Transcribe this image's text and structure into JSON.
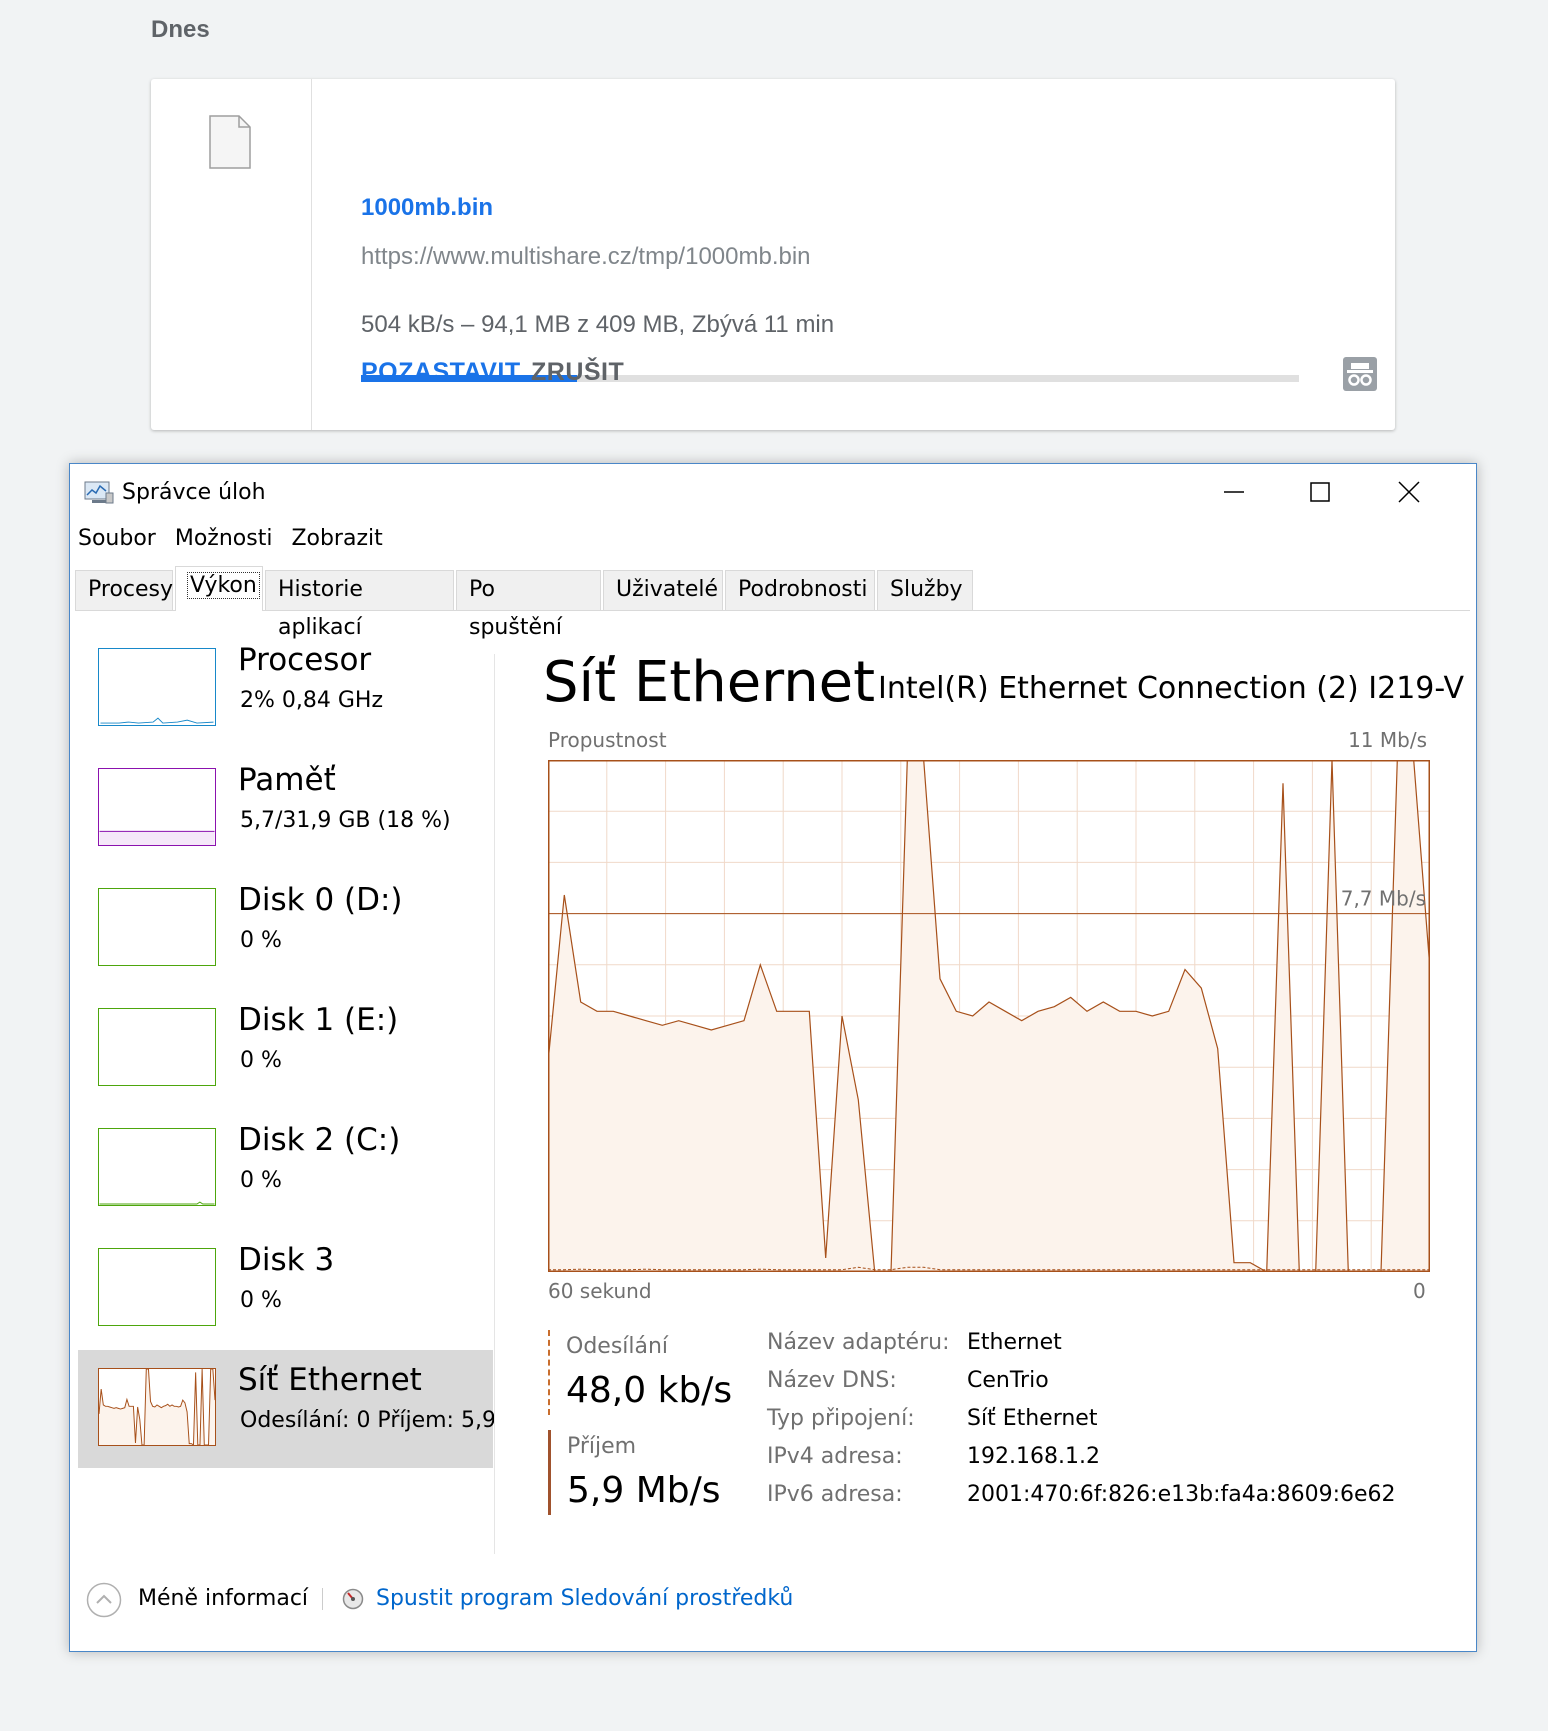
{
  "downloads": {
    "day_label": "Dnes",
    "item": {
      "file_name": "1000mb.bin",
      "url": "https://www.multishare.cz/tmp/1000mb.bin",
      "status": "504 kB/s – 94,1 MB z 409 MB, Zbývá 11 min",
      "progress_fraction": 0.23,
      "pause_label": "POZASTAVIT",
      "cancel_label": "ZRUŠIT",
      "incognito_icon": "incognito-icon"
    },
    "colors": {
      "accent": "#1a73e8",
      "track": "#e0e0e0"
    }
  },
  "task_manager": {
    "title": "Správce úloh",
    "menu": [
      "Soubor",
      "Možnosti",
      "Zobrazit"
    ],
    "tabs": [
      "Procesy",
      "Výkon",
      "Historie aplikací",
      "Po spuštění",
      "Uživatelé",
      "Podrobnosti",
      "Služby"
    ],
    "active_tab": "Výkon",
    "sidebar": [
      {
        "title": "Procesor",
        "sub": "2%  0,84 GHz",
        "color": "#1788c9"
      },
      {
        "title": "Paměť",
        "sub": "5,7/31,9 GB (18 %)",
        "color": "#8b12ae"
      },
      {
        "title": "Disk 0 (D:)",
        "sub": "0 %",
        "color": "#4da60c"
      },
      {
        "title": "Disk 1 (E:)",
        "sub": "0 %",
        "color": "#4da60c"
      },
      {
        "title": "Disk 2 (C:)",
        "sub": "0 %",
        "color": "#4da60c"
      },
      {
        "title": "Disk 3",
        "sub": "0 %",
        "color": "#4da60c"
      },
      {
        "title": "Síť Ethernet",
        "sub": "Odesílání:  0  Příjem:  5,9",
        "color": "#a7501a"
      }
    ],
    "main": {
      "title": "Síť Ethernet",
      "adapter": "Intel(R) Ethernet Connection (2) I219-V",
      "graph": {
        "label_top_left": "Propustnost",
        "label_top_right": "11 Mb/s",
        "label_mid": "7,7 Mb/s",
        "label_bottom_left": "60 sekund",
        "label_bottom_right": "0",
        "y_max": 11,
        "receive_mbps": [
          4.5,
          8.1,
          5.8,
          5.6,
          5.6,
          5.5,
          5.4,
          5.3,
          5.4,
          5.3,
          5.2,
          5.3,
          5.4,
          6.6,
          5.6,
          5.6,
          5.6,
          0.3,
          5.5,
          3.7,
          0.0,
          0.0,
          11,
          11,
          6.3,
          5.6,
          5.5,
          5.8,
          5.6,
          5.4,
          5.6,
          5.7,
          5.9,
          5.6,
          5.8,
          5.6,
          5.6,
          5.5,
          5.6,
          6.5,
          6.1,
          4.8,
          0.2,
          0.2,
          0.0,
          10.5,
          0.0,
          0.0,
          11,
          0.0,
          0.0,
          0.0,
          11,
          11,
          6.5
        ],
        "send_mbps": [
          0.05,
          0.05,
          0.06,
          0.05,
          0.05,
          0.05,
          0.06,
          0.05,
          0.05,
          0.05,
          0.05,
          0.05,
          0.05,
          0.06,
          0.05,
          0.05,
          0.05,
          0.05,
          0.05,
          0.1,
          0.05,
          0.05,
          0.1,
          0.1,
          0.05,
          0.05,
          0.05,
          0.05,
          0.05,
          0.05,
          0.05,
          0.05,
          0.05,
          0.05,
          0.05,
          0.05,
          0.05,
          0.05,
          0.05,
          0.05,
          0.05,
          0.05,
          0.05,
          0.05,
          0.05,
          0.05,
          0.05,
          0.05,
          0.05,
          0.05,
          0.05,
          0.05,
          0.05,
          0.05,
          0.05
        ],
        "line_color": "#a7501a",
        "fill_color": "#fcf3ec",
        "grid_color": "#f0d9c9"
      },
      "send": {
        "label": "Odesílání",
        "value": "48,0 kb/s"
      },
      "receive": {
        "label": "Příjem",
        "value": "5,9 Mb/s"
      },
      "properties": [
        {
          "key": "Název adaptéru:",
          "value": "Ethernet"
        },
        {
          "key": "Název DNS:",
          "value": "CenTrio"
        },
        {
          "key": "Typ připojení:",
          "value": "Síť Ethernet"
        },
        {
          "key": "IPv4 adresa:",
          "value": "192.168.1.2"
        },
        {
          "key": "IPv6 adresa:",
          "value": "2001:470:6f:826:e13b:fa4a:8609:6e62"
        }
      ]
    },
    "footer": {
      "fewer_details": "Méně informací",
      "resource_monitor": "Spustit program Sledování prostředků"
    }
  }
}
